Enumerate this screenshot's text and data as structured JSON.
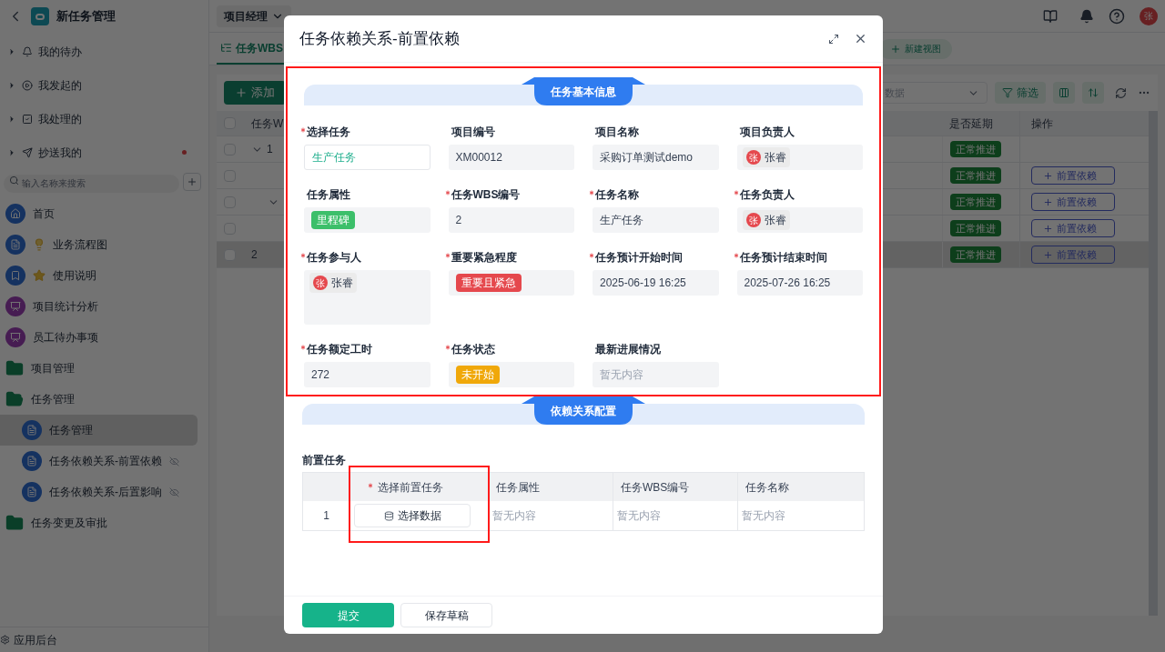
{
  "app": {
    "title": "新任务管理"
  },
  "sidebar": {
    "quick": [
      {
        "label": "我的待办",
        "kind": "bell",
        "badge": false
      },
      {
        "label": "我发起的",
        "kind": "play",
        "badge": false
      },
      {
        "label": "我处理的",
        "kind": "check",
        "badge": false
      },
      {
        "label": "抄送我的",
        "kind": "send",
        "badge": true
      }
    ],
    "search": {
      "placeholder": "输入名称来搜索"
    },
    "nav": [
      {
        "label": "首页",
        "kind": "home",
        "selected": false
      },
      {
        "label": "业务流程图",
        "kind": "doc-bulb",
        "selected": false
      },
      {
        "label": "使用说明",
        "kind": "bookmark-star",
        "selected": false
      },
      {
        "label": "项目统计分析",
        "kind": "chart",
        "selected": false
      },
      {
        "label": "员工待办事项",
        "kind": "chart",
        "selected": false
      },
      {
        "label": "项目管理",
        "kind": "folder",
        "expanded": false,
        "selected": false
      },
      {
        "label": "任务管理",
        "kind": "folder",
        "expanded": true,
        "selected": false,
        "children": [
          {
            "label": "任务管理",
            "kind": "doc",
            "selected": true,
            "hidden": false
          },
          {
            "label": "任务依赖关系-前置依赖",
            "kind": "doc",
            "selected": false,
            "hidden": true
          },
          {
            "label": "任务依赖关系-后置影响",
            "kind": "doc",
            "selected": false,
            "hidden": true
          }
        ]
      },
      {
        "label": "任务变更及审批",
        "kind": "folder",
        "expanded": false,
        "selected": false
      }
    ],
    "footer": "应用后台"
  },
  "header": {
    "role": "项目经理",
    "avatar": "张"
  },
  "tabs": [
    {
      "label": "任务WBS",
      "selected": true
    }
  ],
  "new_view": "新建视图",
  "toolbar": {
    "add": "添加",
    "select_placeholder": "数据",
    "filter": "筛选"
  },
  "table": {
    "columns": [
      "任务W",
      "是否延期",
      "操作"
    ],
    "all_checked": false,
    "rows": [
      {
        "wbs": "1",
        "checked": false,
        "highlighted": false,
        "expanded": true,
        "delay": "正常推进",
        "children": [
          {
            "checked": false,
            "highlighted": false,
            "delay": "正常推进",
            "action": "前置依赖"
          },
          {
            "checked": false,
            "highlighted": false,
            "expanded": true,
            "delay": "正常推进",
            "action": "前置依赖",
            "children": [
              {
                "checked": false,
                "highlighted": false,
                "delay": "正常推进",
                "action": "前置依赖"
              }
            ]
          }
        ]
      },
      {
        "wbs": "2",
        "checked": false,
        "highlighted": true,
        "delay": "正常推进",
        "action": "前置依赖"
      }
    ]
  },
  "modal": {
    "title": "任务依赖关系-前置依赖",
    "section": {
      "title": "任务基本信息",
      "annotated": true,
      "fields": [
        {
          "label": "选择任务",
          "required": true,
          "kind": "select",
          "value": "生产任务"
        },
        {
          "label": "项目编号",
          "required": false,
          "kind": "text",
          "value": "XM00012"
        },
        {
          "label": "项目名称",
          "required": false,
          "kind": "text",
          "value": "采购订单测试demo"
        },
        {
          "label": "项目负责人",
          "required": false,
          "kind": "user",
          "avatar": "张",
          "value": "张睿"
        },
        {
          "label": "任务属性",
          "required": false,
          "kind": "tag",
          "value": "里程碑",
          "color": "#3cbf6a"
        },
        {
          "label": "任务WBS编号",
          "required": true,
          "kind": "text",
          "value": "2"
        },
        {
          "label": "任务名称",
          "required": true,
          "kind": "text",
          "value": "生产任务"
        },
        {
          "label": "任务负责人",
          "required": true,
          "kind": "user",
          "avatar": "张",
          "value": "张睿"
        },
        {
          "label": "任务参与人",
          "required": true,
          "kind": "users",
          "avatar": "张",
          "value": "张睿"
        },
        {
          "label": "重要紧急程度",
          "required": true,
          "kind": "tag",
          "value": "重要且紧急",
          "color": "#e5484d"
        },
        {
          "label": "任务预计开始时间",
          "required": true,
          "kind": "text",
          "value": "2025-06-19 16:25"
        },
        {
          "label": "任务预计结束时间",
          "required": true,
          "kind": "text",
          "value": "2025-07-26 16:25"
        },
        {
          "label": "任务额定工时",
          "required": true,
          "kind": "text",
          "value": "272"
        },
        {
          "label": "任务状态",
          "required": true,
          "kind": "tag",
          "value": "未开始",
          "color": "#f0a80a"
        },
        {
          "label": "最新进展情况",
          "required": false,
          "kind": "empty",
          "placeholder": "暂无内容"
        }
      ]
    },
    "dependency": {
      "title": "依赖关系配置",
      "label": "前置任务",
      "columns": [
        {
          "label": "选择前置任务",
          "required": true,
          "annotated": true
        },
        {
          "label": "任务属性",
          "required": false,
          "annotated": false
        },
        {
          "label": "任务WBS编号",
          "required": false,
          "annotated": false
        },
        {
          "label": "任务名称",
          "required": false,
          "annotated": false
        }
      ],
      "rows": [
        {
          "index": "1",
          "cells": [
            {
              "kind": "button",
              "text": "选择数据"
            },
            {
              "kind": "empty",
              "text": "暂无内容"
            },
            {
              "kind": "empty",
              "text": "暂无内容"
            },
            {
              "kind": "empty",
              "text": "暂无内容"
            }
          ]
        }
      ]
    },
    "buttons": [
      {
        "label": "提交",
        "primary": true
      },
      {
        "label": "保存草稿",
        "primary": false
      }
    ]
  }
}
